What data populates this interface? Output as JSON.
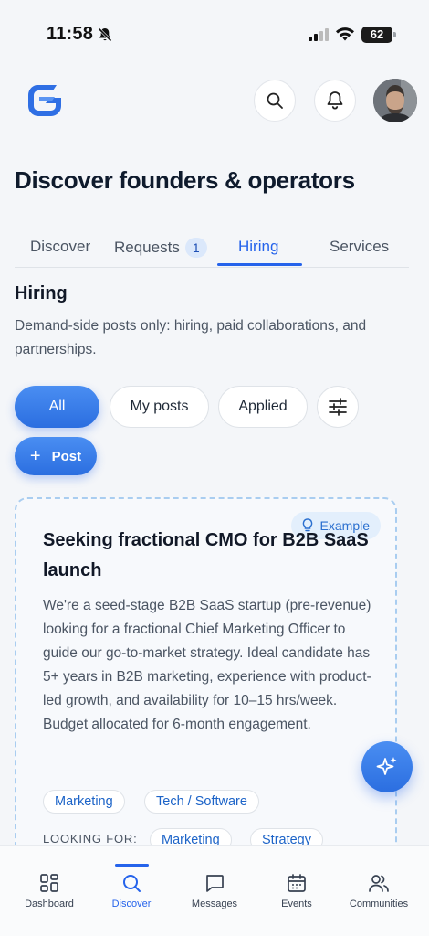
{
  "status_bar": {
    "time": "11:58",
    "battery": "62"
  },
  "header": {
    "logo": "app-logo",
    "search_icon": "search-icon",
    "bell_icon": "bell-icon"
  },
  "page": {
    "title": "Discover founders & operators"
  },
  "tabs": [
    {
      "label": "Discover"
    },
    {
      "label": "Requests",
      "badge": "1"
    },
    {
      "label": "Hiring",
      "active": true
    },
    {
      "label": "Services"
    }
  ],
  "section": {
    "title": "Hiring",
    "description": "Demand-side posts only: hiring, paid collaborations, and partnerships."
  },
  "filters": {
    "all": "All",
    "my_posts": "My posts",
    "applied": "Applied",
    "post_button": "Post"
  },
  "card": {
    "badge": "Example",
    "title": "Seeking fractional CMO for B2B SaaS launch",
    "body": "We're a seed-stage B2B SaaS startup (pre-revenue) looking for a fractional Chief Marketing Officer to guide our go-to-market strategy. Ideal candidate has 5+ years in B2B marketing, experience with product-led growth, and availability for 10–15 hrs/week. Budget allocated for 6-month engagement.",
    "tags": [
      "Marketing",
      "Tech / Software"
    ],
    "looking_for_label": "LOOKING FOR:",
    "looking_for": [
      "Marketing",
      "Strategy"
    ]
  },
  "bottom_nav": [
    {
      "label": "Dashboard",
      "icon": "grid-icon"
    },
    {
      "label": "Discover",
      "icon": "search-icon",
      "active": true
    },
    {
      "label": "Messages",
      "icon": "message-icon"
    },
    {
      "label": "Events",
      "icon": "calendar-icon"
    },
    {
      "label": "Communities",
      "icon": "people-icon"
    }
  ],
  "colors": {
    "accent": "#2563eb",
    "background": "#f4f6f9",
    "card_border": "#a9cdf0"
  }
}
